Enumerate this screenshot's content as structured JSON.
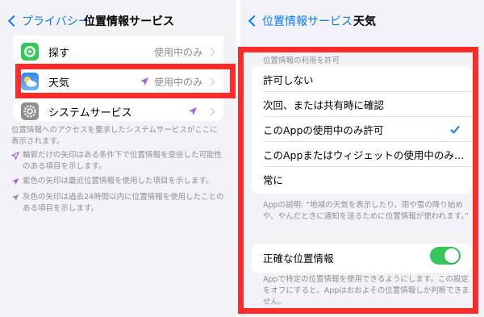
{
  "left": {
    "back_label": "プライバシー",
    "title": "位置情報サービス",
    "rows": [
      {
        "label": "探す",
        "value": "使用中のみ",
        "icon": "find-my-icon"
      },
      {
        "label": "天気",
        "value": "使用中のみ",
        "icon": "weather-icon"
      },
      {
        "label": "システムサービス",
        "value": "",
        "icon": "settings-gear-icon"
      }
    ],
    "footer": "位置情報へのアクセスを要求したシステムサービスがここに表示されます。",
    "legend": [
      {
        "text": "輪郭だけの矢印はある条件下で位置情報を受信した可能性のある項目を示します。",
        "arrow": "outline-purple"
      },
      {
        "text": "紫色の矢印は最近位置情報を使用した項目を示します。",
        "arrow": "purple"
      },
      {
        "text": "灰色の矢印は過去24時間以内に位置情報を使用したことのある項目を示します。",
        "arrow": "gray"
      }
    ]
  },
  "right": {
    "back_label": "位置情報サービス",
    "title": "天気",
    "section_header": "位置情報の利用を許可",
    "options": [
      {
        "label": "許可しない",
        "selected": false
      },
      {
        "label": "次回、または共有時に確認",
        "selected": false
      },
      {
        "label": "このAppの使用中のみ許可",
        "selected": true
      },
      {
        "label": "このAppまたはウィジェットの使用中のみ…",
        "selected": false
      },
      {
        "label": "常に",
        "selected": false
      }
    ],
    "app_description": "Appの説明: “地域の天気を表示したり、雨や雪の降り始めや、やんだときに通知を送るために位置情報が使われます。”",
    "precise_label": "正確な位置情報",
    "precise_on": true,
    "precise_footer": "Appで特定の位置情報を使用できるようにします。この設定をオフにすると、Appはおおよその位置情報しか判断できません。"
  },
  "colors": {
    "accent": "#0a7aff",
    "toggle_on": "#34c759",
    "highlight": "#ff2a2a",
    "location_arrow": "#a259f0"
  }
}
